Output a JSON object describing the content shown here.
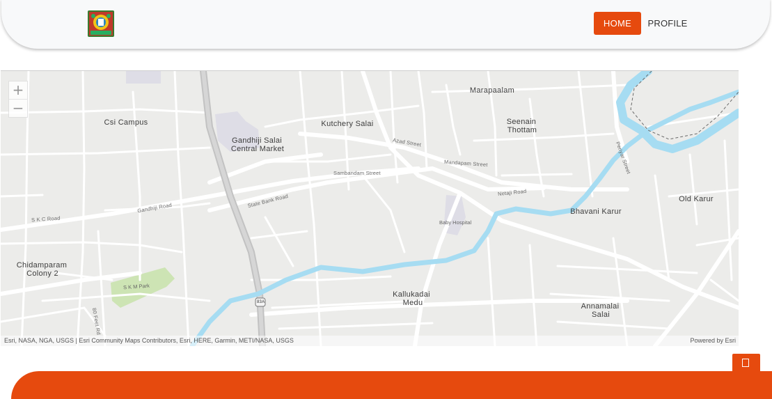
{
  "header": {
    "logo": "district-emblem-logo",
    "nav": {
      "home_label": "HOME",
      "profile_label": "PROFILE"
    },
    "accent_color": "#e64a0e"
  },
  "map": {
    "zoom_in": "+",
    "zoom_out": "−",
    "places": {
      "marapaalam": "Marapaalam",
      "csi_campus": "Csi Campus",
      "kutchery_salai": "Kutchery Salai",
      "seenain": "Seenain",
      "thottam": "Thottam",
      "gandhiji_1": "Gandhiji Salai",
      "gandhiji_2": "Central Market",
      "old_karur": "Old Karur",
      "bhavani_karur": "Bhavani Karur",
      "chidam_1": "Chidamparam",
      "chidam_2": "Colony 2",
      "kallu_1": "Kallukadai",
      "kallu_2": "Medu",
      "anna_1": "Annamalai",
      "anna_2": "Salai"
    },
    "roads": {
      "azad": "Azad Street",
      "mandapam": "Mandapam Street",
      "sambandam": "Sambandam Street",
      "netaji": "Netaji Road",
      "periyar": "Periyar Street",
      "state_bank": "State Bank Road",
      "gandhiji_road": "Gandhiji Road",
      "skc": "S K C Road",
      "eighty_feet": "80 Feet Rd",
      "highway": "83A"
    },
    "pois": {
      "baby_hospital": "Baby Hospital",
      "skm_park": "S  K  M Park"
    },
    "attribution": "Esri, NASA, NGA, USGS | Esri Community Maps Contributors, Esri, HERE, Garmin, METI/NASA, USGS",
    "powered_by": "Powered by Esri",
    "colors": {
      "land": "#ececea",
      "road": "#ffffff",
      "highway": "#c9c9c9",
      "river": "#a6dcf2",
      "park": "#cde4b4"
    }
  },
  "footer": {
    "corner_icon": "square-icon"
  }
}
